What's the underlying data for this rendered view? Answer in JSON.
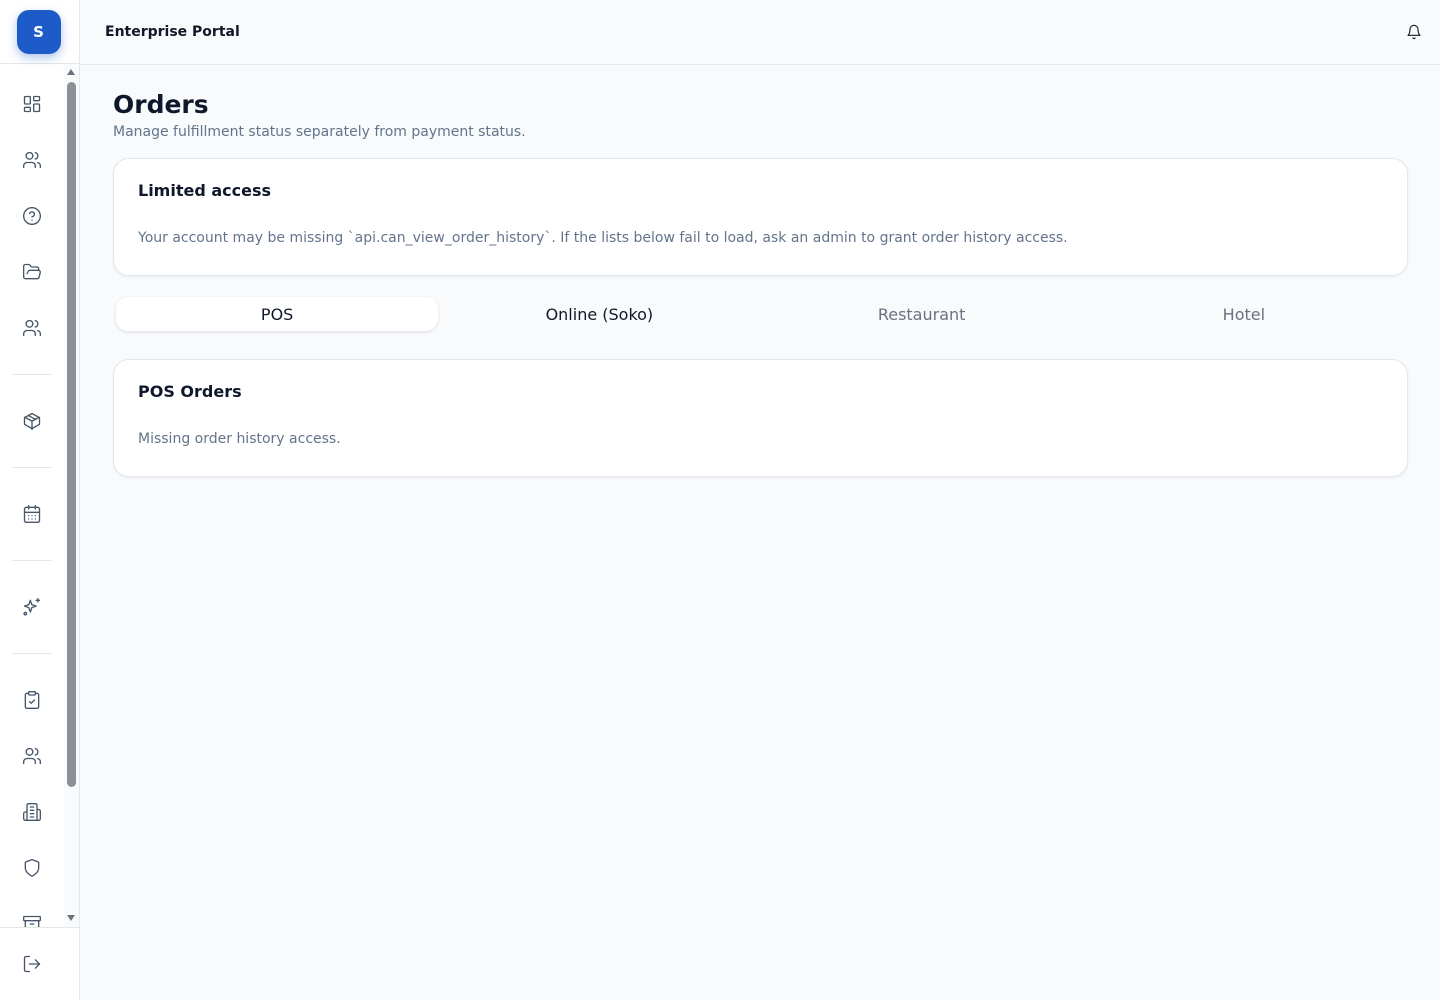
{
  "app": {
    "title": "Enterprise Portal",
    "logo_letter": "S"
  },
  "sidebar": {
    "items": [
      {
        "icon": "dashboard-icon"
      },
      {
        "icon": "users-icon"
      },
      {
        "icon": "help-circle-icon"
      },
      {
        "icon": "folder-open-icon"
      },
      {
        "icon": "users-icon"
      },
      {
        "icon": "package-icon"
      },
      {
        "icon": "calendar-icon"
      },
      {
        "icon": "sparkles-icon"
      },
      {
        "icon": "clipboard-check-icon"
      },
      {
        "icon": "users-icon"
      },
      {
        "icon": "building-icon"
      },
      {
        "icon": "shield-icon"
      },
      {
        "icon": "archive-icon"
      }
    ],
    "logout_icon": "logout-icon"
  },
  "header": {
    "notifications_icon": "bell-icon"
  },
  "page": {
    "title": "Orders",
    "subtitle": "Manage fulfillment status separately from payment status."
  },
  "access_notice": {
    "title": "Limited access",
    "message": "Your account may be missing `api.can_view_order_history`. If the lists below fail to load, ask an admin to grant order history access."
  },
  "tabs": [
    {
      "label": "POS",
      "state": "active"
    },
    {
      "label": "Online (Soko)",
      "state": "normal"
    },
    {
      "label": "Restaurant",
      "state": "muted"
    },
    {
      "label": "Hotel",
      "state": "muted"
    }
  ],
  "orders_card": {
    "title": "POS Orders",
    "message": "Missing order history access."
  },
  "colors": {
    "brand": "#1d5cc8",
    "background": "#f8fafc",
    "muted_text": "#64748b"
  }
}
